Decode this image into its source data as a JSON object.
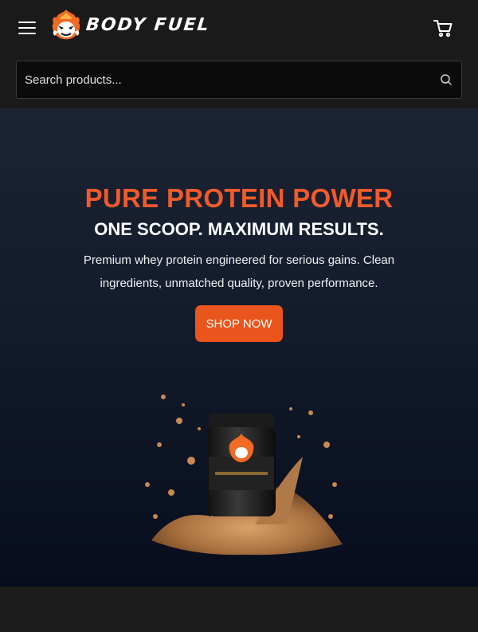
{
  "header": {
    "brand": "BODY FUEL",
    "menu_icon": "hamburger-menu-icon",
    "cart_icon": "shopping-cart-icon"
  },
  "search": {
    "placeholder": "Search products...",
    "value": "",
    "icon": "search-icon"
  },
  "hero": {
    "title": "PURE PROTEIN POWER",
    "subtitle": "ONE SCOOP. MAXIMUM RESULTS.",
    "description": "Premium whey protein engineered for serious gains. Clean ingredients, unmatched quality, proven performance.",
    "cta_label": "SHOP NOW",
    "image": "protein-tub-powder-splash"
  },
  "colors": {
    "accent": "#f15a2b",
    "button": "#e9551c",
    "header_bg": "#1a1a1a",
    "hero_top": "#1c2433",
    "hero_bottom": "#070d1c"
  }
}
